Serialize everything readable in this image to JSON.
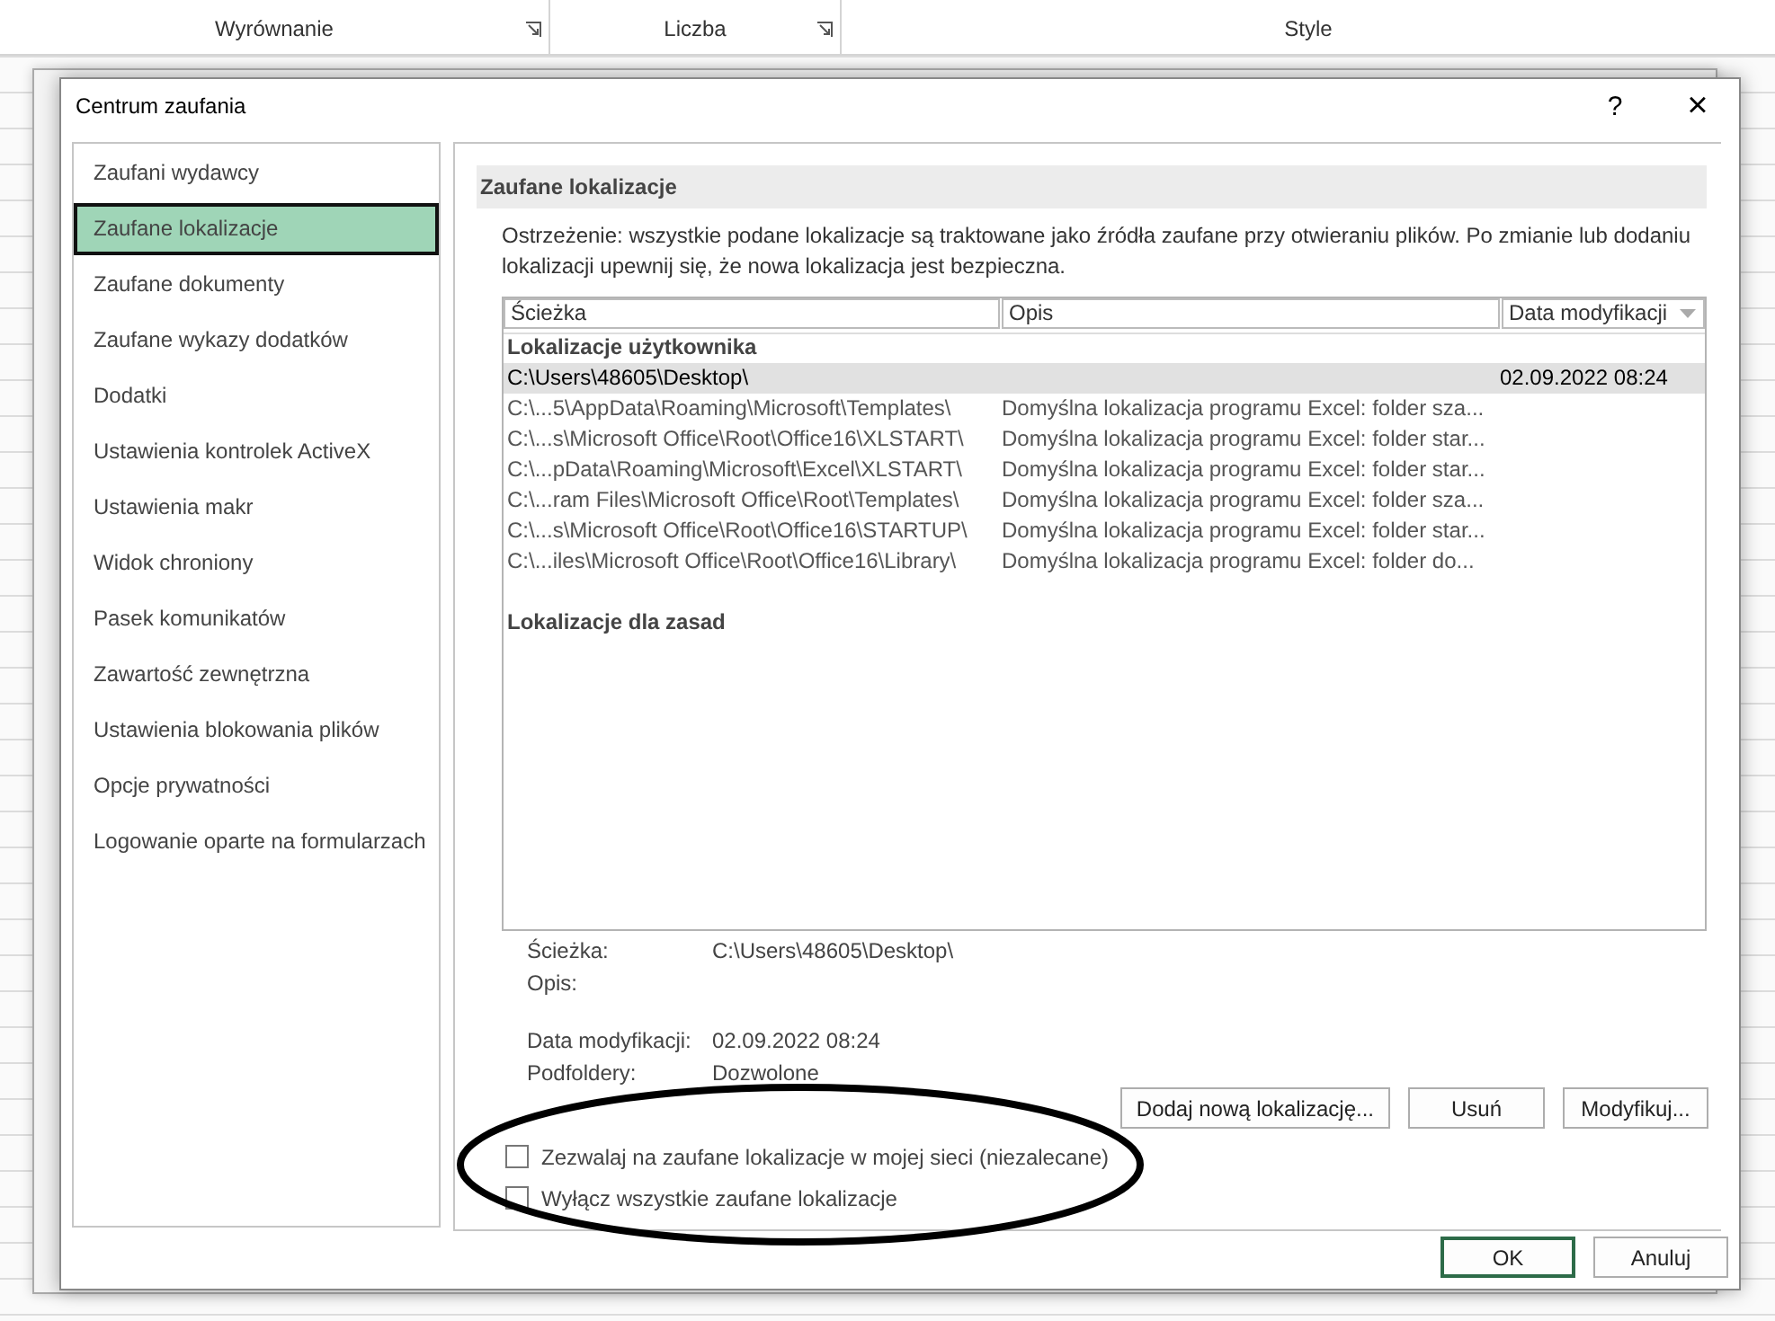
{
  "ribbon": {
    "groups": [
      {
        "label": "Wyrównanie",
        "launcher": true
      },
      {
        "label": "Liczba",
        "launcher": true
      },
      {
        "label": "Style",
        "launcher": false
      }
    ]
  },
  "dialog": {
    "title": "Centrum zaufania",
    "help": "?",
    "close": "×"
  },
  "sidebar": {
    "items": [
      {
        "label": "Zaufani wydawcy",
        "selected": false
      },
      {
        "label": "Zaufane lokalizacje",
        "selected": true
      },
      {
        "label": "Zaufane dokumenty",
        "selected": false
      },
      {
        "label": "Zaufane wykazy dodatków",
        "selected": false
      },
      {
        "label": "Dodatki",
        "selected": false
      },
      {
        "label": "Ustawienia kontrolek ActiveX",
        "selected": false
      },
      {
        "label": "Ustawienia makr",
        "selected": false
      },
      {
        "label": "Widok chroniony",
        "selected": false
      },
      {
        "label": "Pasek komunikatów",
        "selected": false
      },
      {
        "label": "Zawartość zewnętrzna",
        "selected": false
      },
      {
        "label": "Ustawienia blokowania plików",
        "selected": false
      },
      {
        "label": "Opcje prywatności",
        "selected": false
      },
      {
        "label": "Logowanie oparte na formularzach",
        "selected": false
      }
    ]
  },
  "section": {
    "title": "Zaufane lokalizacje",
    "warning": "Ostrzeżenie: wszystkie podane lokalizacje są traktowane jako źródła zaufane przy otwieraniu plików. Po zmianie lub dodaniu lokalizacji upewnij się, że nowa lokalizacja jest bezpieczna."
  },
  "table": {
    "columns": [
      "Ścieżka",
      "Opis",
      "Data modyfikacji"
    ],
    "rows": [
      {
        "kind": "group",
        "label": "Lokalizacje użytkownika"
      },
      {
        "kind": "row",
        "selected": true,
        "cells": [
          "C:\\Users\\48605\\Desktop\\",
          "",
          "02.09.2022 08:24"
        ]
      },
      {
        "kind": "row",
        "selected": false,
        "cells": [
          "C:\\...5\\AppData\\Roaming\\Microsoft\\Templates\\",
          "Domyślna lokalizacja programu Excel: folder sza...",
          ""
        ]
      },
      {
        "kind": "row",
        "selected": false,
        "cells": [
          "C:\\...s\\Microsoft Office\\Root\\Office16\\XLSTART\\",
          "Domyślna lokalizacja programu Excel: folder star...",
          ""
        ]
      },
      {
        "kind": "row",
        "selected": false,
        "cells": [
          "C:\\...pData\\Roaming\\Microsoft\\Excel\\XLSTART\\",
          "Domyślna lokalizacja programu Excel: folder star...",
          ""
        ]
      },
      {
        "kind": "row",
        "selected": false,
        "cells": [
          "C:\\...ram Files\\Microsoft Office\\Root\\Templates\\",
          "Domyślna lokalizacja programu Excel: folder sza...",
          ""
        ]
      },
      {
        "kind": "row",
        "selected": false,
        "cells": [
          "C:\\...s\\Microsoft Office\\Root\\Office16\\STARTUP\\",
          "Domyślna lokalizacja programu Excel: folder star...",
          ""
        ]
      },
      {
        "kind": "row",
        "selected": false,
        "cells": [
          "C:\\...iles\\Microsoft Office\\Root\\Office16\\Library\\",
          "Domyślna lokalizacja programu Excel: folder do...",
          ""
        ]
      },
      {
        "kind": "spacer"
      },
      {
        "kind": "group",
        "label": "Lokalizacje dla zasad"
      }
    ]
  },
  "details": [
    {
      "label": "Ścieżka:",
      "value": "C:\\Users\\48605\\Desktop\\"
    },
    {
      "label": "Opis:"
    },
    {
      "kind": "gap"
    },
    {
      "label": "Data modyfikacji:",
      "value": "02.09.2022 08:24"
    },
    {
      "label": "Podfoldery:",
      "value": "Dozwolone"
    }
  ],
  "actions": [
    "Dodaj nową lokalizację...",
    "Usuń",
    "Modyfikuj..."
  ],
  "checkboxes": [
    {
      "label": "Zezwalaj na zaufane lokalizacje w mojej sieci (niezalecane)",
      "checked": false
    },
    {
      "label": "Wyłącz wszystkie zaufane lokalizacje",
      "checked": false
    }
  ],
  "buttons": [
    {
      "label": "OK",
      "default": true
    },
    {
      "label": "Anuluj",
      "default": false
    }
  ]
}
